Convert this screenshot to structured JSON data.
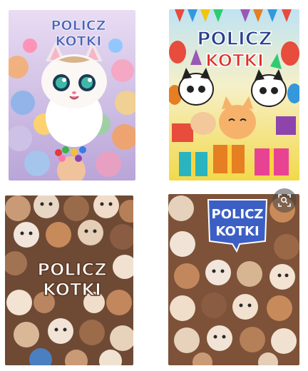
{
  "cards": [
    {
      "line1": "POLICZ",
      "line2": "KOTKI",
      "palette": {
        "bg": "#d9c6e8",
        "accent": "#4a63b8"
      }
    },
    {
      "line1": "POLICZ",
      "line2": "KOTKI",
      "palette": {
        "bg": "#f4df63",
        "accent": "#2b3f8f",
        "accent2": "#e0302a"
      }
    },
    {
      "line1": "POLICZ",
      "line2": "KOTKI",
      "palette": {
        "bg": "#7a4f35",
        "accent": "#ffffff"
      }
    },
    {
      "line1": "POLICZ",
      "line2": "KOTKI",
      "palette": {
        "bg": "#8a5a3e",
        "accent": "#3b5fc4"
      }
    }
  ],
  "icons": {
    "lens": "visual-search-icon"
  }
}
